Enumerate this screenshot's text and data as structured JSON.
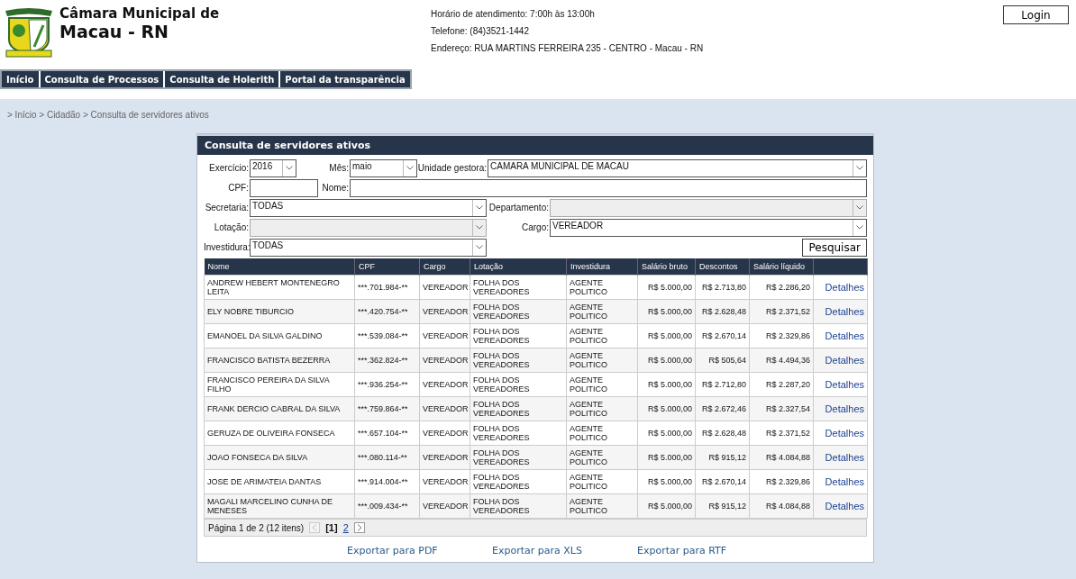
{
  "header": {
    "title_line1": "Câmara Municipal de",
    "title_line2": "Macau - RN",
    "info": [
      "Horário de atendimento: 7:00h às 13:00h",
      "Telefone: (84)3521-1442",
      "Endereço: RUA MARTINS FERREIRA 235 - CENTRO - Macau - RN"
    ],
    "login": "Login"
  },
  "nav": [
    "Início",
    "Consulta de Processos",
    "Consulta de Holerith",
    "Portal da transparência"
  ],
  "breadcrumb": "> Início > Cidadão > Consulta de servidores ativos",
  "panel": {
    "title": "Consulta de servidores ativos"
  },
  "filters": [
    [
      {
        "kind": "select",
        "label": "Exercício:",
        "value": "2016",
        "disabled": false
      },
      {
        "kind": "select",
        "label": "Mês:",
        "value": "maio",
        "disabled": false
      },
      {
        "kind": "select",
        "label": "Unidade gestora:",
        "value": "CAMARA MUNICIPAL DE MACAU",
        "disabled": false
      }
    ],
    [
      {
        "kind": "text",
        "label": "CPF:",
        "disabled": false
      },
      {
        "kind": "text",
        "label": "Nome:",
        "disabled": false
      }
    ],
    [
      {
        "kind": "select",
        "label": "Secretaria:",
        "value": "TODAS",
        "disabled": false
      },
      {
        "kind": "select",
        "label": "Departamento:",
        "disabled": true
      }
    ],
    [
      {
        "kind": "select",
        "label": "Lotação:",
        "disabled": true
      },
      {
        "kind": "select",
        "label": "Cargo:",
        "value": "VEREADOR",
        "disabled": false
      }
    ],
    [
      {
        "kind": "select",
        "label": "Investidura:",
        "value": "TODAS",
        "disabled": false
      },
      {
        "kind": "button",
        "label": "Pesquisar"
      }
    ]
  ],
  "table": {
    "columns": [
      "Nome",
      "CPF",
      "Cargo",
      "Lotação",
      "Investidura",
      "Salário bruto",
      "Descontos",
      "Salário líquido"
    ],
    "rows": [
      {
        "cells": [
          "ANDREW HEBERT MONTENEGRO LEITA",
          "***.701.984-**",
          "VEREADOR",
          "FOLHA DOS VEREADORES",
          "AGENTE POLITICO",
          "R$ 5.000,00",
          "R$ 2.713,80",
          "R$ 2.286,20"
        ],
        "link": "Detalhes"
      },
      {
        "cells": [
          "ELY NOBRE TIBURCIO",
          "***.420.754-**",
          "VEREADOR",
          "FOLHA DOS VEREADORES",
          "AGENTE POLITICO",
          "R$ 5.000,00",
          "R$ 2.628,48",
          "R$ 2.371,52"
        ],
        "link": "Detalhes"
      },
      {
        "cells": [
          "EMANOEL DA SILVA GALDINO",
          "***.539.084-**",
          "VEREADOR",
          "FOLHA DOS VEREADORES",
          "AGENTE POLITICO",
          "R$ 5.000,00",
          "R$ 2.670,14",
          "R$ 2.329,86"
        ],
        "link": "Detalhes"
      },
      {
        "cells": [
          "FRANCISCO BATISTA BEZERRA",
          "***.362.824-**",
          "VEREADOR",
          "FOLHA DOS VEREADORES",
          "AGENTE POLITICO",
          "R$ 5.000,00",
          "R$ 505,64",
          "R$ 4.494,36"
        ],
        "link": "Detalhes"
      },
      {
        "cells": [
          "FRANCISCO PEREIRA DA SILVA FILHO",
          "***.936.254-**",
          "VEREADOR",
          "FOLHA DOS VEREADORES",
          "AGENTE POLITICO",
          "R$ 5.000,00",
          "R$ 2.712,80",
          "R$ 2.287,20"
        ],
        "link": "Detalhes"
      },
      {
        "cells": [
          "FRANK DERCIO CABRAL DA SILVA",
          "***.759.864-**",
          "VEREADOR",
          "FOLHA DOS VEREADORES",
          "AGENTE POLITICO",
          "R$ 5.000,00",
          "R$ 2.672,46",
          "R$ 2.327,54"
        ],
        "link": "Detalhes"
      },
      {
        "cells": [
          "GERUZA DE OLIVEIRA FONSECA",
          "***.657.104-**",
          "VEREADOR",
          "FOLHA DOS VEREADORES",
          "AGENTE POLITICO",
          "R$ 5.000,00",
          "R$ 2.628,48",
          "R$ 2.371,52"
        ],
        "link": "Detalhes"
      },
      {
        "cells": [
          "JOAO FONSECA DA SILVA",
          "***.080.114-**",
          "VEREADOR",
          "FOLHA DOS VEREADORES",
          "AGENTE POLITICO",
          "R$ 5.000,00",
          "R$ 915,12",
          "R$ 4.084,88"
        ],
        "link": "Detalhes"
      },
      {
        "cells": [
          "JOSE DE ARIMATEIA DANTAS",
          "***.914.004-**",
          "VEREADOR",
          "FOLHA DOS VEREADORES",
          "AGENTE POLITICO",
          "R$ 5.000,00",
          "R$ 2.670,14",
          "R$ 2.329,86"
        ],
        "link": "Detalhes"
      },
      {
        "cells": [
          "MAGALI MARCELINO CUNHA DE MENESES",
          "***.009.434-**",
          "VEREADOR",
          "FOLHA DOS VEREADORES",
          "AGENTE POLITICO",
          "R$ 5.000,00",
          "R$ 915,12",
          "R$ 4.084,88"
        ],
        "link": "Detalhes"
      }
    ]
  },
  "pager": {
    "summary": "Página 1 de 2 (12 itens)",
    "prev_disabled": true,
    "next_disabled": false,
    "pages": [
      {
        "label": "[1]",
        "selected": true
      },
      {
        "label": "2",
        "selected": false
      }
    ]
  },
  "exports": [
    "Exportar para PDF",
    "Exportar para XLS",
    "Exportar para RTF"
  ]
}
